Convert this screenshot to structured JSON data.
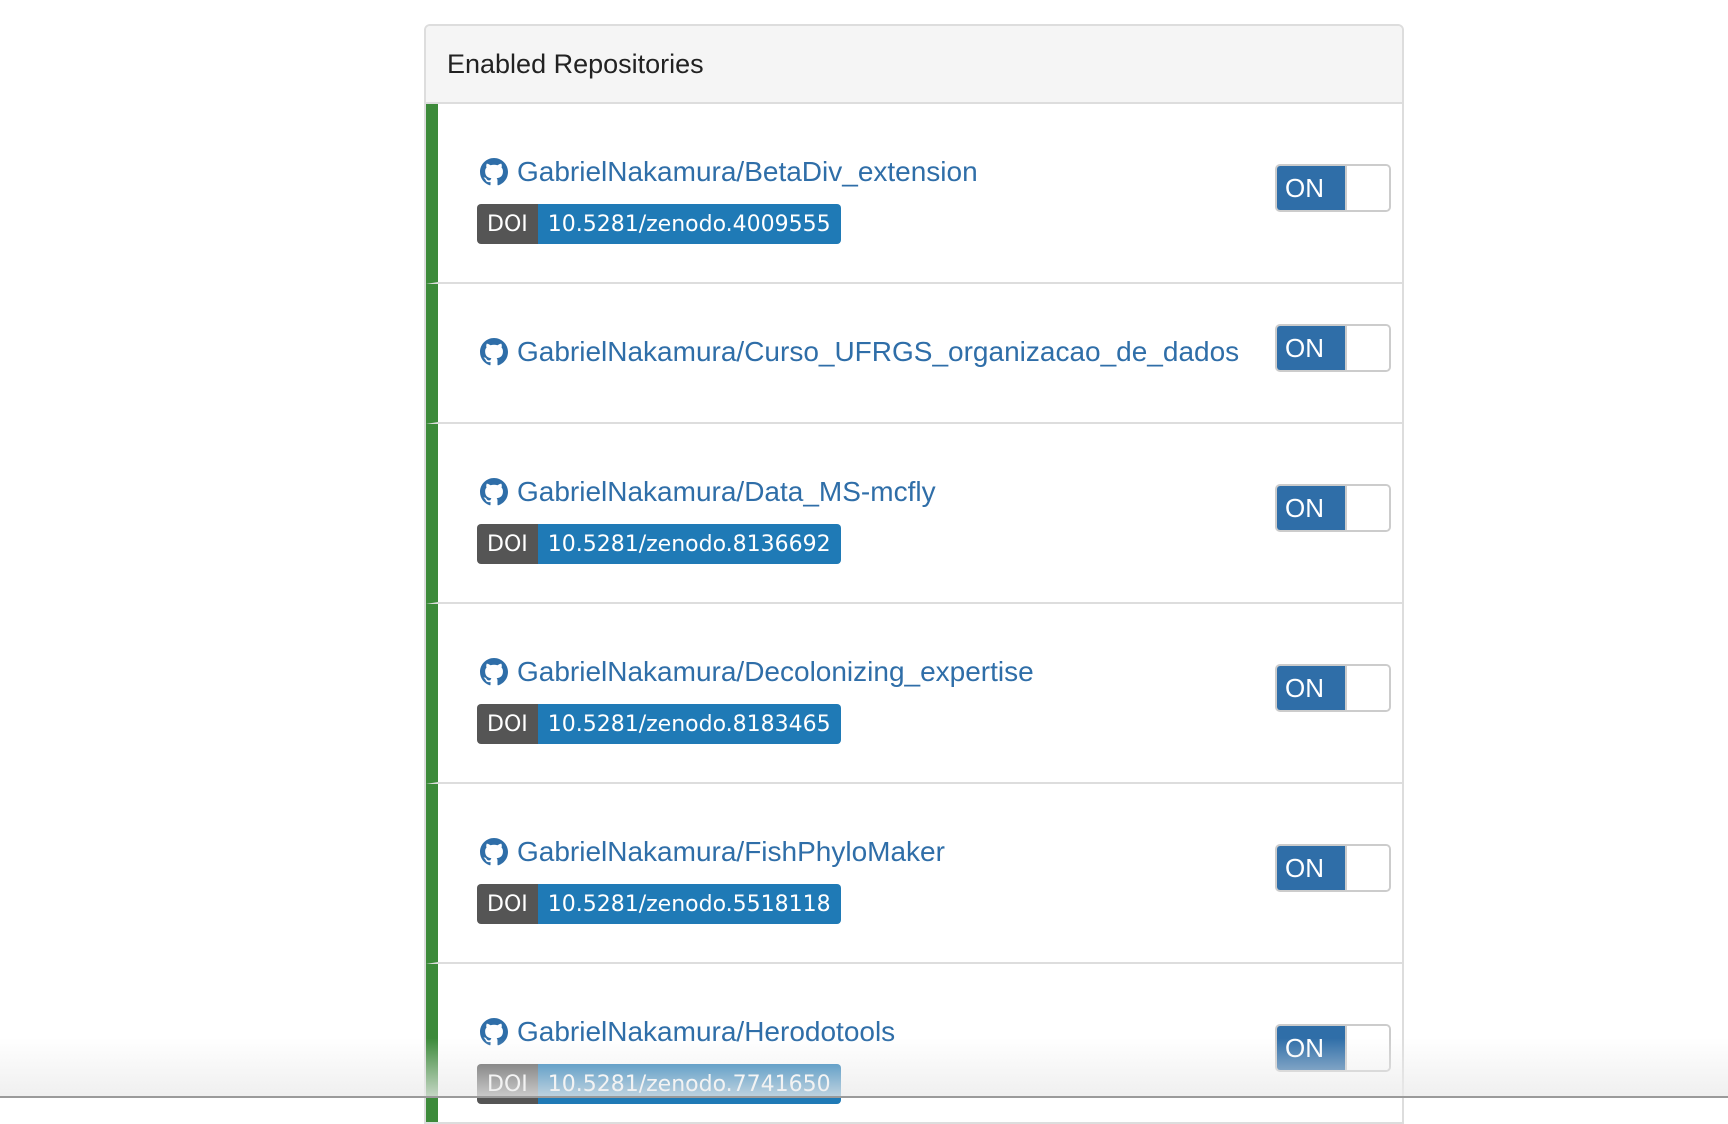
{
  "panel": {
    "title": "Enabled Repositories"
  },
  "repositories": [
    {
      "name": "GabrielNakamura/BetaDiv_extension",
      "doi_label": "DOI",
      "doi": "10.5281/zenodo.4009555",
      "switch": "ON"
    },
    {
      "name": "GabrielNakamura/Curso_UFRGS_organizacao_de_dados",
      "doi_label": "",
      "doi": "",
      "switch": "ON"
    },
    {
      "name": "GabrielNakamura/Data_MS-mcfly",
      "doi_label": "DOI",
      "doi": "10.5281/zenodo.8136692",
      "switch": "ON"
    },
    {
      "name": "GabrielNakamura/Decolonizing_expertise",
      "doi_label": "DOI",
      "doi": "10.5281/zenodo.8183465",
      "switch": "ON"
    },
    {
      "name": "GabrielNakamura/FishPhyloMaker",
      "doi_label": "DOI",
      "doi": "10.5281/zenodo.5518118",
      "switch": "ON"
    },
    {
      "name": "GabrielNakamura/Herodotools",
      "doi_label": "DOI",
      "doi": "10.5281/zenodo.7741650",
      "switch": "ON"
    }
  ],
  "icons": {
    "repo_icon": "github-icon"
  },
  "colors": {
    "accent_bar": "#3c8a3a",
    "link": "#2f6ea8",
    "doi_label_bg": "#555555",
    "doi_value_bg": "#1f7ab6",
    "switch_on_bg": "#2f6ea8"
  }
}
